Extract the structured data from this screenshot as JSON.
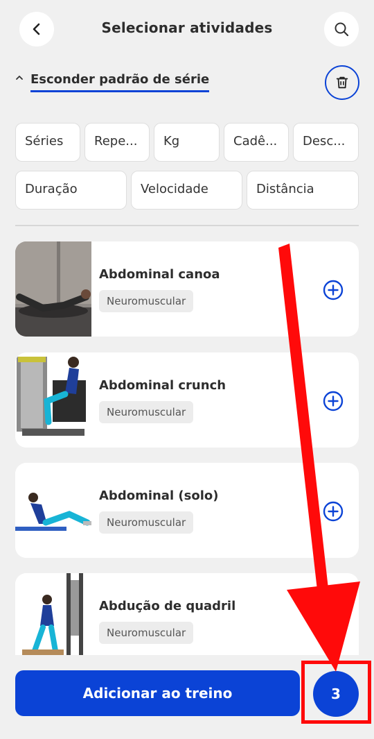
{
  "header": {
    "title": "Selecionar atividades",
    "back_icon": "chevron-left-icon",
    "search_icon": "search-icon"
  },
  "series_toggle": {
    "label": "Esconder padrão de série",
    "caret_icon": "chevron-up-icon",
    "delete_icon": "trash-icon"
  },
  "fields": [
    "Séries",
    "Repe...",
    "Kg",
    "Cadê...",
    "Desc...",
    "Duração",
    "Velocidade",
    "Distância"
  ],
  "activities": [
    {
      "name": "Abdominal canoa",
      "tag": "Neuromuscular"
    },
    {
      "name": "Abdominal crunch",
      "tag": "Neuromuscular"
    },
    {
      "name": "Abdominal (solo)",
      "tag": "Neuromuscular"
    },
    {
      "name": "Abdução de quadril",
      "tag": "Neuromuscular"
    }
  ],
  "footer": {
    "add_label": "Adicionar ao treino",
    "selected_count": "3"
  },
  "colors": {
    "accent": "#0b43d6",
    "background": "#f0f0f0",
    "annotation": "#ff0a0a"
  }
}
